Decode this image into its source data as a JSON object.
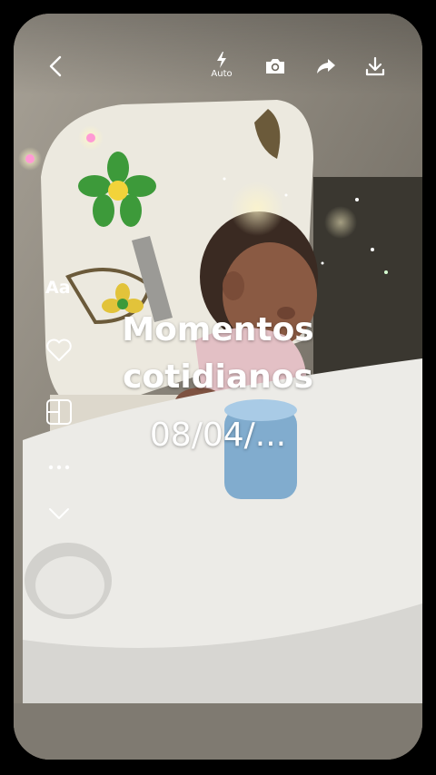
{
  "toolbar": {
    "back_icon": "chevron-left-icon",
    "flash_icon": "flash-icon",
    "flash_label": "Auto",
    "camera_icon": "camera-icon",
    "share_icon": "share-icon",
    "download_icon": "download-icon"
  },
  "side_menu": {
    "text_label": "Aa",
    "like_icon": "heart-icon",
    "layout_icon": "layout-grid-icon",
    "more_icon": "more-dots-icon",
    "expand_icon": "chevron-down-icon"
  },
  "story": {
    "title": "Momentos cotidianos",
    "date": "08/04/..."
  },
  "colors": {
    "foreground": "#ffffff",
    "background": "#000000"
  }
}
